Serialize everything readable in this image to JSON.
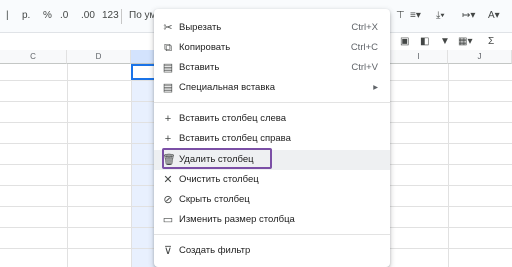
{
  "toolbar": {
    "currency": "р.",
    "percent": "%",
    "dec_decrease": ".0",
    "dec_increase": ".00",
    "number_format": "123",
    "font_family": "По ум"
  },
  "sheet": {
    "columns": [
      "C",
      "D",
      "",
      "I",
      "J"
    ]
  },
  "menu": {
    "items": [
      {
        "icon": "scissors-icon",
        "label": "Вырезать",
        "shortcut": "Ctrl+X"
      },
      {
        "icon": "copy-icon",
        "label": "Копировать",
        "shortcut": "Ctrl+C"
      },
      {
        "icon": "paste-icon",
        "label": "Вставить",
        "shortcut": "Ctrl+V"
      },
      {
        "icon": "paste-special-icon",
        "label": "Специальная вставка",
        "shortcut": "▸"
      },
      {
        "icon": "plus-icon",
        "label": "Вставить столбец слева"
      },
      {
        "icon": "plus-icon",
        "label": "Вставить столбец справа"
      },
      {
        "icon": "trash-icon",
        "label": "Удалить столбец"
      },
      {
        "icon": "close-icon",
        "label": "Очистить столбец"
      },
      {
        "icon": "eye-off-icon",
        "label": "Скрыть столбец"
      },
      {
        "icon": "resize-icon",
        "label": "Изменить размер столбца"
      },
      {
        "icon": "filter-icon",
        "label": "Создать фильтр"
      }
    ]
  }
}
